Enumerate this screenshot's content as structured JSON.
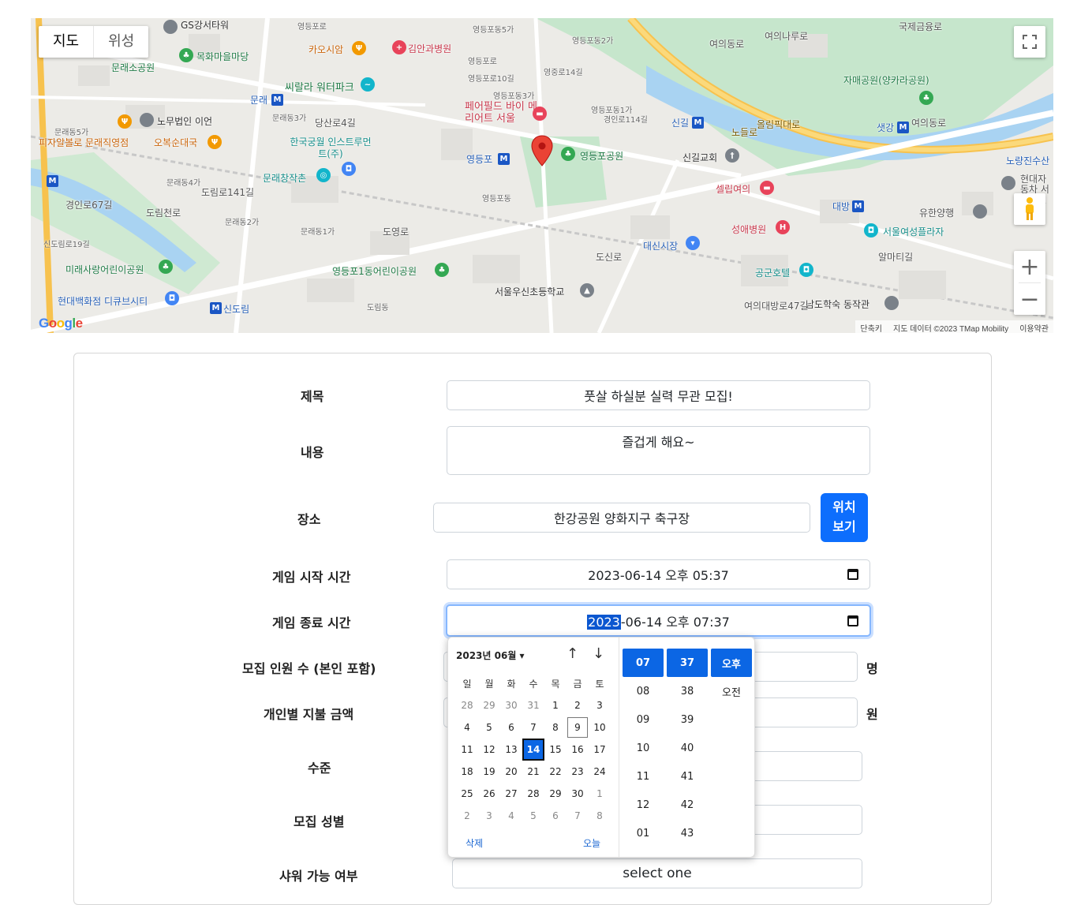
{
  "map": {
    "type_buttons": [
      "지도",
      "위성"
    ],
    "fullscreen_icon": "fullscreen-icon",
    "pegman_icon": "pegman-icon",
    "zoom_in": "+",
    "zoom_out": "−",
    "logo": "Google",
    "attribution": [
      "단축키",
      "지도 데이터 ©2023 TMap Mobility",
      "이용약관"
    ],
    "labels": [
      "GS강서타워",
      "영등포로",
      "영등포동5가",
      "영등포동2가",
      "목화마을마당",
      "카오시암",
      "김안과병원",
      "문래소공원",
      "씨랄라 워터파크",
      "영등포로",
      "영등포로10길",
      "영중로14길",
      "페어필드 바이 메리어트 서울",
      "영등포동3가",
      "영등포동1가",
      "경인로114길",
      "신길",
      "문래",
      "문래동3가",
      "당산로4길",
      "노무법인 이언",
      "문래동5가",
      "피자알볼로 문래직영점",
      "오복순대국",
      "한국궁월 인스트루먼트(주)",
      "영등포",
      "영등포공원",
      "신길교회",
      "문래창작촌",
      "문래동4가",
      "도림천로",
      "경인로67길",
      "도림로141길",
      "문래동2가",
      "문래동1가",
      "도영로",
      "영등포동",
      "신도림로19길",
      "미래사랑어린이공원",
      "영등포1동어린이공원",
      "도신로",
      "셀립여의",
      "성애병원",
      "대신시장",
      "공군호텔",
      "서울우신초등학교",
      "현대백화점 디큐브시티",
      "신도림",
      "도림동",
      "남도학숙 동작관",
      "여의대방로47길",
      "자매공원(양카라공원)",
      "올림픽대로",
      "노들로",
      "샛강",
      "여의동로",
      "대방",
      "유한양행",
      "서울여성플라자",
      "알마티길",
      "노량진수산",
      "현대자동차 서비스센터",
      "국제금융로",
      "여의나루로",
      "여의동로"
    ]
  },
  "form": {
    "title_label": "제목",
    "title_value": "풋살 하실분 실력 무관 모집!",
    "content_label": "내용",
    "content_value": "즐겁게 해요~",
    "place_label": "장소",
    "place_value": "한강공원 양화지구 축구장",
    "place_button": "위치 보기",
    "start_label": "게임 시작 시간",
    "start_value": "2023-06-14 오후 05:37",
    "end_label": "게임 종료 시간",
    "end_value_selected": "2023",
    "end_value_rest": "-06-14 오후 07:37",
    "people_label": "모집 인원 수 (본인 포함)",
    "people_unit": "명",
    "fee_label": "개인별 지불 금액",
    "fee_unit": "원",
    "level_label": "수준",
    "gender_label": "모집 성별",
    "shower_label": "샤워 가능 여부",
    "shower_value": "select one"
  },
  "picker": {
    "month_label": "2023년 06월 ▾",
    "weekdays": [
      "일",
      "월",
      "화",
      "수",
      "목",
      "금",
      "토"
    ],
    "days": [
      {
        "d": "28",
        "m": true
      },
      {
        "d": "29",
        "m": true
      },
      {
        "d": "30",
        "m": true
      },
      {
        "d": "31",
        "m": true
      },
      {
        "d": "1"
      },
      {
        "d": "2"
      },
      {
        "d": "3"
      },
      {
        "d": "4"
      },
      {
        "d": "5"
      },
      {
        "d": "6"
      },
      {
        "d": "7"
      },
      {
        "d": "8"
      },
      {
        "d": "9",
        "today": true
      },
      {
        "d": "10"
      },
      {
        "d": "11"
      },
      {
        "d": "12"
      },
      {
        "d": "13"
      },
      {
        "d": "14",
        "selected": true
      },
      {
        "d": "15"
      },
      {
        "d": "16"
      },
      {
        "d": "17"
      },
      {
        "d": "18"
      },
      {
        "d": "19"
      },
      {
        "d": "20"
      },
      {
        "d": "21"
      },
      {
        "d": "22"
      },
      {
        "d": "23"
      },
      {
        "d": "24"
      },
      {
        "d": "25"
      },
      {
        "d": "26"
      },
      {
        "d": "27"
      },
      {
        "d": "28"
      },
      {
        "d": "29"
      },
      {
        "d": "30"
      },
      {
        "d": "1",
        "m": true
      },
      {
        "d": "2",
        "m": true
      },
      {
        "d": "3",
        "m": true
      },
      {
        "d": "4",
        "m": true
      },
      {
        "d": "5",
        "m": true
      },
      {
        "d": "6",
        "m": true
      },
      {
        "d": "7",
        "m": true
      },
      {
        "d": "8",
        "m": true
      }
    ],
    "hours": [
      "07",
      "08",
      "09",
      "10",
      "11",
      "12",
      "01"
    ],
    "minutes": [
      "37",
      "38",
      "39",
      "40",
      "41",
      "42",
      "43"
    ],
    "ampm": [
      "오후",
      "오전"
    ],
    "clear_label": "삭제",
    "today_label": "오늘"
  }
}
